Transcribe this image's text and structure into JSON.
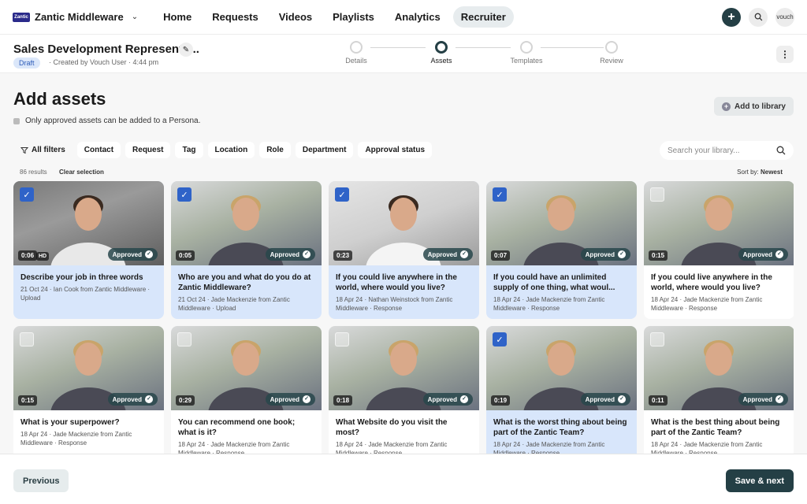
{
  "colors": {
    "brand_dark": "#243f45",
    "selected_card": "#d8e6fb",
    "checkbox_checked": "#2f63c8",
    "draft_badge": "#dbe7fa"
  },
  "nav": {
    "org_logo": "Zantic",
    "org_name": "Zantic Middleware",
    "links": [
      "Home",
      "Requests",
      "Videos",
      "Playlists",
      "Analytics",
      "Recruiter"
    ],
    "active": "Recruiter",
    "create_icon": "plus-icon",
    "search_icon": "search-icon",
    "account_label": "vouch"
  },
  "header": {
    "title": "Sales Development Representa...",
    "status": "Draft",
    "created": "· Created by Vouch User · 4:44 pm",
    "steps": [
      "Details",
      "Assets",
      "Templates",
      "Review"
    ],
    "active_step": "Assets"
  },
  "main": {
    "page_title": "Add assets",
    "notice": "Only approved assets can be added to a Persona.",
    "add_to_library": "Add to library",
    "filters": [
      "All filters",
      "Contact",
      "Request",
      "Tag",
      "Location",
      "Role",
      "Department",
      "Approval status"
    ],
    "search_placeholder": "Search your library...",
    "results_count": "86 results",
    "clear_selection": "Clear selection",
    "sort_label": "Sort by:",
    "sort_value": "Newest"
  },
  "cards": [
    {
      "title": "Describe your job in three words",
      "meta": "21 Oct 24 · Ian Cook from Zantic Middleware · Upload",
      "duration": "0:06",
      "hd": "HD",
      "status": "Approved",
      "selected": true
    },
    {
      "title": "Who are you and what do you do at Zantic Middleware?",
      "meta": "21 Oct 24 · Jade Mackenzie from Zantic Middleware · Upload",
      "duration": "0:05",
      "status": "Approved",
      "selected": true
    },
    {
      "title": "If you could live anywhere in the world, where would you live?",
      "meta": "18 Apr 24 · Nathan Weinstock from Zantic Middleware · Response",
      "duration": "0:23",
      "status": "Approved",
      "selected": true
    },
    {
      "title": "If you could have an unlimited supply of one thing, what woul...",
      "meta": "18 Apr 24 · Jade Mackenzie from Zantic Middleware · Response",
      "duration": "0:07",
      "status": "Approved",
      "selected": true
    },
    {
      "title": "If you could live anywhere in the world, where would you live?",
      "meta": "18 Apr 24 · Jade Mackenzie from Zantic Middleware · Response",
      "duration": "0:15",
      "status": "Approved",
      "selected": false
    },
    {
      "title": "What is your superpower?",
      "meta": "18 Apr 24 · Jade Mackenzie from Zantic Middleware · Response",
      "duration": "0:15",
      "status": "Approved",
      "selected": false
    },
    {
      "title": "You can recommend one book; what is it?",
      "meta": "18 Apr 24 · Jade Mackenzie from Zantic Middleware · Response",
      "duration": "0:29",
      "status": "Approved",
      "selected": false
    },
    {
      "title": "What Website do you visit the most?",
      "meta": "18 Apr 24 · Jade Mackenzie from Zantic Middleware · Response",
      "duration": "0:18",
      "status": "Approved",
      "selected": false
    },
    {
      "title": "What is the worst thing about being part of the Zantic Team?",
      "meta": "18 Apr 24 · Jade Mackenzie from Zantic Middleware · Response",
      "duration": "0:19",
      "status": "Approved",
      "selected": true
    },
    {
      "title": "What is the best thing about being part of the Zantic Team?",
      "meta": "18 Apr 24 · Jade Mackenzie from Zantic Middleware · Response",
      "duration": "0:11",
      "status": "Approved",
      "selected": false
    }
  ],
  "footer": {
    "previous": "Previous",
    "save_next": "Save & next"
  }
}
